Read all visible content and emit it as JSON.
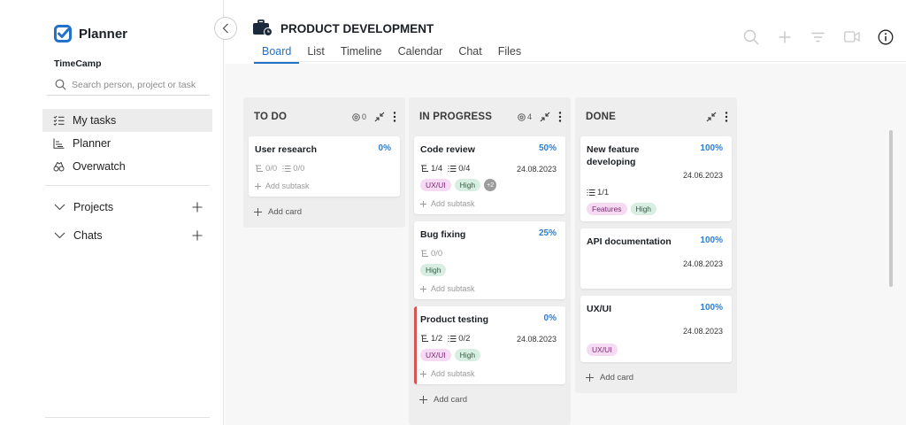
{
  "app": {
    "name": "Planner",
    "workspace": "TimeCamp",
    "search_placeholder": "Search person, project or task",
    "brand_color": "#2272c9"
  },
  "sidebar": {
    "items": [
      {
        "label": "My tasks",
        "icon": "checklist-icon",
        "active": true
      },
      {
        "label": "Planner",
        "icon": "chart-icon",
        "active": false
      },
      {
        "label": "Overwatch",
        "icon": "binoculars-icon",
        "active": false
      }
    ],
    "sections": [
      {
        "label": "Projects"
      },
      {
        "label": "Chats"
      }
    ]
  },
  "header": {
    "title": "PRODUCT DEVELOPMENT",
    "tabs": [
      "Board",
      "List",
      "Timeline",
      "Calendar",
      "Chat",
      "Files"
    ],
    "active_tab": "Board"
  },
  "board": {
    "add_card_label": "Add card",
    "add_subtask_label": "Add subtask",
    "columns": [
      {
        "title": "TO DO",
        "count": "0",
        "cards": [
          {
            "title": "User research",
            "percent": "0%",
            "subtasks": "0/0",
            "checklist": "0/0",
            "date": "",
            "tags": []
          }
        ]
      },
      {
        "title": "IN PROGRESS",
        "count": "4",
        "cards": [
          {
            "title": "Code review",
            "percent": "50%",
            "subtasks": "1/4",
            "checklist": "0/4",
            "date": "24.08.2023",
            "tags": [
              "UX/UI",
              "High"
            ],
            "more": "+2"
          },
          {
            "title": "Bug fixing",
            "percent": "25%",
            "subtasks": "0/0",
            "checklist": "",
            "date": "",
            "tags": [
              "High"
            ]
          },
          {
            "title": "Product testing",
            "percent": "0%",
            "subtasks": "1/2",
            "checklist": "0/2",
            "date": "24.08.2023",
            "tags": [
              "UX/UI",
              "High"
            ],
            "flag_color": "#d9534f"
          }
        ]
      },
      {
        "title": "DONE",
        "count": "",
        "cards": [
          {
            "title": "New feature developing",
            "percent": "100%",
            "checklist": "1/1",
            "date": "24.06.2023",
            "tags": [
              "Features",
              "High"
            ]
          },
          {
            "title": "API documentation",
            "percent": "100%",
            "date": "24.08.2023",
            "tags": []
          },
          {
            "title": "UX/UI",
            "percent": "100%",
            "date": "24.08.2023",
            "tags": [
              "UX/UI"
            ]
          }
        ]
      }
    ]
  }
}
